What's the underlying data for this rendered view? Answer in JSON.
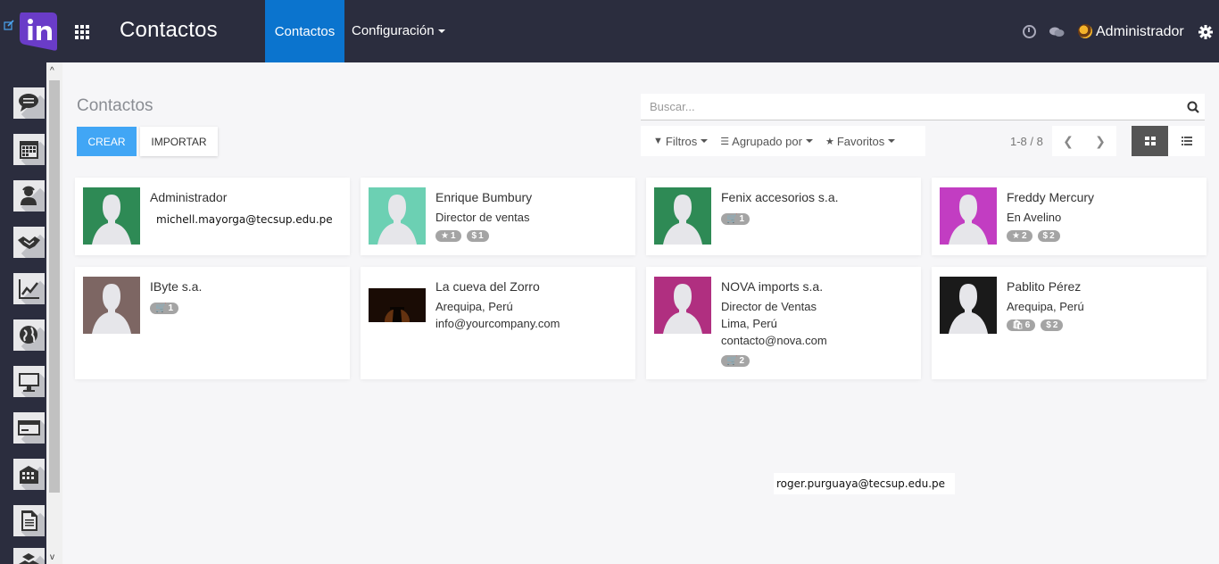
{
  "app": {
    "title": "Contactos",
    "colors": {
      "navbar": "#2b2d3e",
      "active_tab": "#0b74ce",
      "create_button": "#41a6f5",
      "logo": "#6a3cc8"
    }
  },
  "topnav": {
    "menu_contacts": "Contactos",
    "menu_config": "Configuración",
    "user_name": "Administrador",
    "icons": [
      "edit-icon",
      "apps-icon",
      "clock-icon",
      "chat-icon",
      "user-avatar",
      "gear-icon"
    ]
  },
  "sidebar": {
    "items": [
      {
        "icon": "discuss-icon"
      },
      {
        "icon": "calendar-icon"
      },
      {
        "icon": "contacts-icon"
      },
      {
        "icon": "crm-handshake-icon"
      },
      {
        "icon": "sales-chart-icon"
      },
      {
        "icon": "website-globe-icon"
      },
      {
        "icon": "pos-monitor-icon"
      },
      {
        "icon": "invoicing-card-icon"
      },
      {
        "icon": "inventory-building-icon"
      },
      {
        "icon": "document-icon"
      },
      {
        "icon": "boxes-icon"
      }
    ]
  },
  "control_panel": {
    "breadcrumb": "Contactos",
    "create_label": "CREAR",
    "import_label": "IMPORTAR",
    "search_placeholder": "Buscar...",
    "filters_label": "Filtros",
    "group_by_label": "Agrupado por",
    "favorites_label": "Favoritos",
    "pager_value": "1-8 / 8"
  },
  "contacts": [
    {
      "name": "Administrador",
      "avatar_bg": "#2e8a55",
      "lines": [],
      "badges": []
    },
    {
      "name": "Enrique Bumbury",
      "avatar_bg": "#6cd0b3",
      "lines": [
        "Director de ventas"
      ],
      "badges": [
        {
          "icon": "★",
          "count": "1"
        },
        {
          "icon": "$",
          "count": "1"
        }
      ]
    },
    {
      "name": "Fenix accesorios s.a.",
      "avatar_bg": "#2e8a55",
      "lines": [],
      "badges": [
        {
          "icon": "🛒",
          "count": "1"
        }
      ]
    },
    {
      "name": "Freddy Mercury",
      "avatar_bg": "#c23dc2",
      "lines": [
        "En Avelino"
      ],
      "badges": [
        {
          "icon": "★",
          "count": "2"
        },
        {
          "icon": "$",
          "count": "2"
        }
      ]
    },
    {
      "name": "IByte s.a.",
      "avatar_bg": "#7d6663",
      "lines": [],
      "badges": [
        {
          "icon": "🛒",
          "count": "1"
        }
      ]
    },
    {
      "name": "La cueva del Zorro",
      "avatar_bg": "#1a0c05",
      "lines": [
        "Arequipa, Perú",
        "info@yourcompany.com"
      ],
      "badges": []
    },
    {
      "name": "NOVA imports s.a.",
      "avatar_bg": "#b02f80",
      "lines": [
        "Director de Ventas",
        "Lima, Perú",
        "contacto@nova.com"
      ],
      "badges": [
        {
          "icon": "🛒",
          "count": "2"
        }
      ]
    },
    {
      "name": "Pablito Pérez",
      "avatar_bg": "#1a1a1a",
      "lines": [
        "Arequipa, Perú"
      ],
      "badges": [
        {
          "icon": "🛍",
          "count": "6"
        },
        {
          "icon": "$",
          "count": "2"
        }
      ]
    }
  ],
  "overlays": {
    "email_1": "michell.mayorga@tecsup.edu.pe",
    "email_2": "roger.purguaya@tecsup.edu.pe"
  }
}
